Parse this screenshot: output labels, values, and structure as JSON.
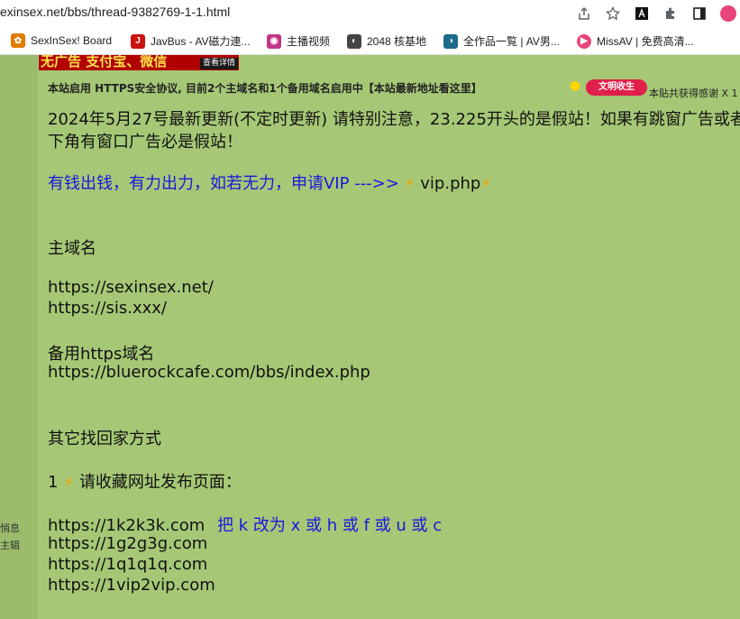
{
  "browser": {
    "url": "exinsex.net/bbs/thread-9382769-1-1.html",
    "bookmarks": [
      {
        "label": "SexInSex! Board",
        "color": "#e07b00",
        "glyph": "✿"
      },
      {
        "label": "JavBus - AV磁力連...",
        "color": "#cc1111",
        "glyph": "J"
      },
      {
        "label": "主播视频",
        "color": "#c13584",
        "glyph": "◉"
      },
      {
        "label": "2048 核基地",
        "color": "#444444",
        "glyph": "◐"
      },
      {
        "label": "全作品一覧 | AV男...",
        "color": "#1c6b8a",
        "glyph": "◑"
      },
      {
        "label": "MissAV | 免费高清...",
        "color": "#e8457a",
        "glyph": "▶"
      }
    ]
  },
  "sidebar": {
    "text1": "悄息",
    "text2": "主辑"
  },
  "post": {
    "banner_text": "无广告 支付宝、微信",
    "banner_button": "查看详情",
    "notice": "本站启用 HTTPS安全协议, 目前2个主域名和1个备用域名启用中【本站最新地址看这里】",
    "award_badge": "文明收生",
    "award_text": "本贴共获得感谢 X 1",
    "update_line1": "2024年5月27号最新更新(不定时更新) 请特别注意，23.225开头的是假站！如果有跳窗广告或者",
    "update_line2": "下角有窗口广告必是假站！",
    "vip_text": "有钱出钱，有力出力，如若无力，申请VIP --->>",
    "vip_link": "vip.php",
    "main_domain_title": "主域名",
    "main_domain_1": "https://sexinsex.net/",
    "main_domain_2": "https://sis.xxx/",
    "backup_title": "备用https域名",
    "backup_url": "https://bluerockcafe.com/bbs/index.php",
    "other_title": "其它找回家方式",
    "item1_num": "1",
    "item1_text": "请收藏网址发布页面：",
    "url_1": "https://1k2k3k.com",
    "url_1_hint": "把 k 改为 x 或 h 或 f 或 u 或 c",
    "url_2": "https://1g2g3g.com",
    "url_3": "https://1q1q1q.com",
    "url_4": "https://1vip2vip.com"
  }
}
